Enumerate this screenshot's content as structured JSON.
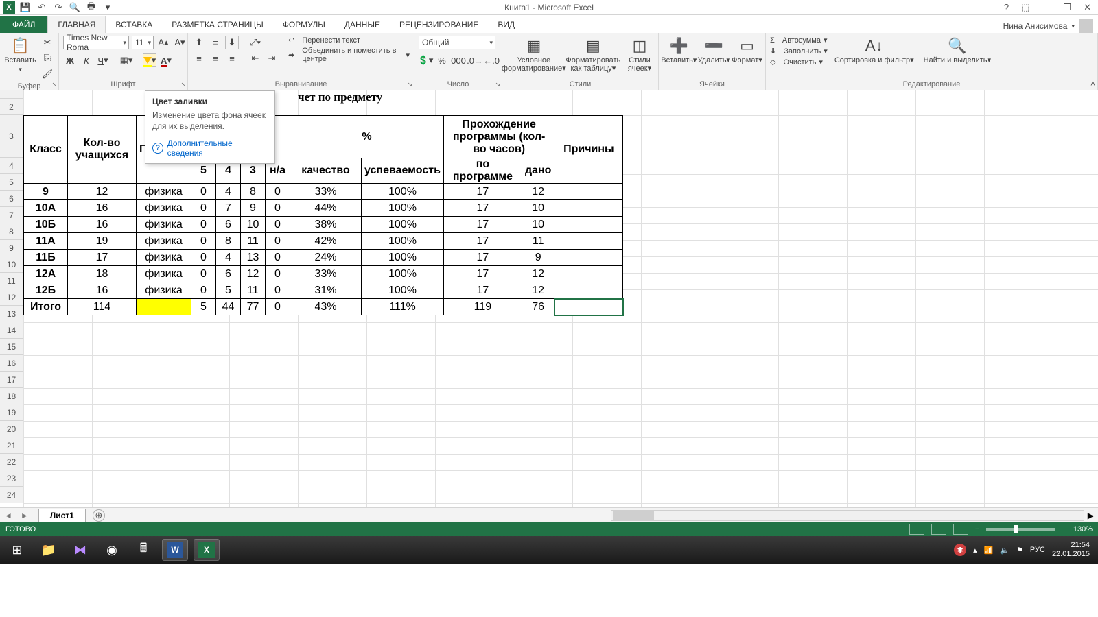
{
  "titlebar": {
    "title": "Книга1 - Microsoft Excel"
  },
  "user": {
    "name": "Нина Анисимова"
  },
  "tabs": {
    "file": "ФАЙЛ",
    "items": [
      "ГЛАВНАЯ",
      "ВСТАВКА",
      "РАЗМЕТКА СТРАНИЦЫ",
      "ФОРМУЛЫ",
      "ДАННЫЕ",
      "РЕЦЕНЗИРОВАНИЕ",
      "ВИД"
    ],
    "active": 0
  },
  "ribbon": {
    "clipboard": {
      "paste": "Вставить",
      "label": "Буфер обмена"
    },
    "font": {
      "name": "Times New Roma",
      "size": "11",
      "bold": "Ж",
      "italic": "К",
      "underline": "Ч",
      "label": "Шрифт"
    },
    "alignment": {
      "wrap": "Перенести текст",
      "merge": "Объединить и поместить в центре",
      "label": "Выравнивание"
    },
    "number": {
      "format": "Общий",
      "label": "Число"
    },
    "styles": {
      "cond": "Условное форматирование",
      "table": "Форматировать как таблицу",
      "cell": "Стили ячеек",
      "label": "Стили"
    },
    "cells": {
      "insert": "Вставить",
      "delete": "Удалить",
      "format": "Формат",
      "label": "Ячейки"
    },
    "editing": {
      "sum": "Автосумма",
      "fill": "Заполнить",
      "clear": "Очистить",
      "sort": "Сортировка и фильтр",
      "find": "Найти и выделить",
      "label": "Редактирование"
    }
  },
  "tooltip": {
    "title": "Цвет заливки",
    "body": "Изменение цвета фона ячеек для их выделения.",
    "link": "Дополнительные сведения"
  },
  "sheet_title_visible": "чет по предмету",
  "table": {
    "headers": {
      "class": "Класс",
      "students": "Кол-во учащихся",
      "subject_prefix": "П",
      "percent": "%",
      "program": "Прохождение программы (кол-во часов)",
      "reasons": "Причины",
      "g5": "5",
      "g4": "4",
      "g3": "3",
      "na": "н/а",
      "quality": "качество",
      "success": "успеваемость",
      "byprog": "по программе",
      "given": "дано"
    },
    "rows": [
      {
        "class": "9",
        "count": "12",
        "subj": "физика",
        "g5": "0",
        "g4": "4",
        "g3": "8",
        "na": "0",
        "qual": "33%",
        "succ": "100%",
        "prog": "17",
        "given": "12"
      },
      {
        "class": "10А",
        "count": "16",
        "subj": "физика",
        "g5": "0",
        "g4": "7",
        "g3": "9",
        "na": "0",
        "qual": "44%",
        "succ": "100%",
        "prog": "17",
        "given": "10"
      },
      {
        "class": "10Б",
        "count": "16",
        "subj": "физика",
        "g5": "0",
        "g4": "6",
        "g3": "10",
        "na": "0",
        "qual": "38%",
        "succ": "100%",
        "prog": "17",
        "given": "10"
      },
      {
        "class": "11А",
        "count": "19",
        "subj": "физика",
        "g5": "0",
        "g4": "8",
        "g3": "11",
        "na": "0",
        "qual": "42%",
        "succ": "100%",
        "prog": "17",
        "given": "11"
      },
      {
        "class": "11Б",
        "count": "17",
        "subj": "физика",
        "g5": "0",
        "g4": "4",
        "g3": "13",
        "na": "0",
        "qual": "24%",
        "succ": "100%",
        "prog": "17",
        "given": "9"
      },
      {
        "class": "12А",
        "count": "18",
        "subj": "физика",
        "g5": "0",
        "g4": "6",
        "g3": "12",
        "na": "0",
        "qual": "33%",
        "succ": "100%",
        "prog": "17",
        "given": "12"
      },
      {
        "class": "12Б",
        "count": "16",
        "subj": "физика",
        "g5": "0",
        "g4": "5",
        "g3": "11",
        "na": "0",
        "qual": "31%",
        "succ": "100%",
        "prog": "17",
        "given": "12"
      }
    ],
    "total": {
      "class": "Итого",
      "count": "114",
      "subj": "",
      "g5": "5",
      "g4": "44",
      "g3": "77",
      "na": "0",
      "qual": "43%",
      "succ": "111%",
      "prog": "119",
      "given": "76"
    }
  },
  "row_numbers": [
    "2",
    "3",
    "4",
    "5",
    "6",
    "7",
    "8",
    "9",
    "10",
    "11",
    "12",
    "13",
    "14",
    "15",
    "16",
    "17",
    "18",
    "19",
    "20",
    "21",
    "22",
    "23",
    "24"
  ],
  "sheettab": {
    "name": "Лист1"
  },
  "statusbar": {
    "ready": "ГОТОВО",
    "zoom": "130%"
  },
  "taskbar": {
    "lang": "РУС",
    "time": "21:54",
    "date": "22.01.2015"
  }
}
